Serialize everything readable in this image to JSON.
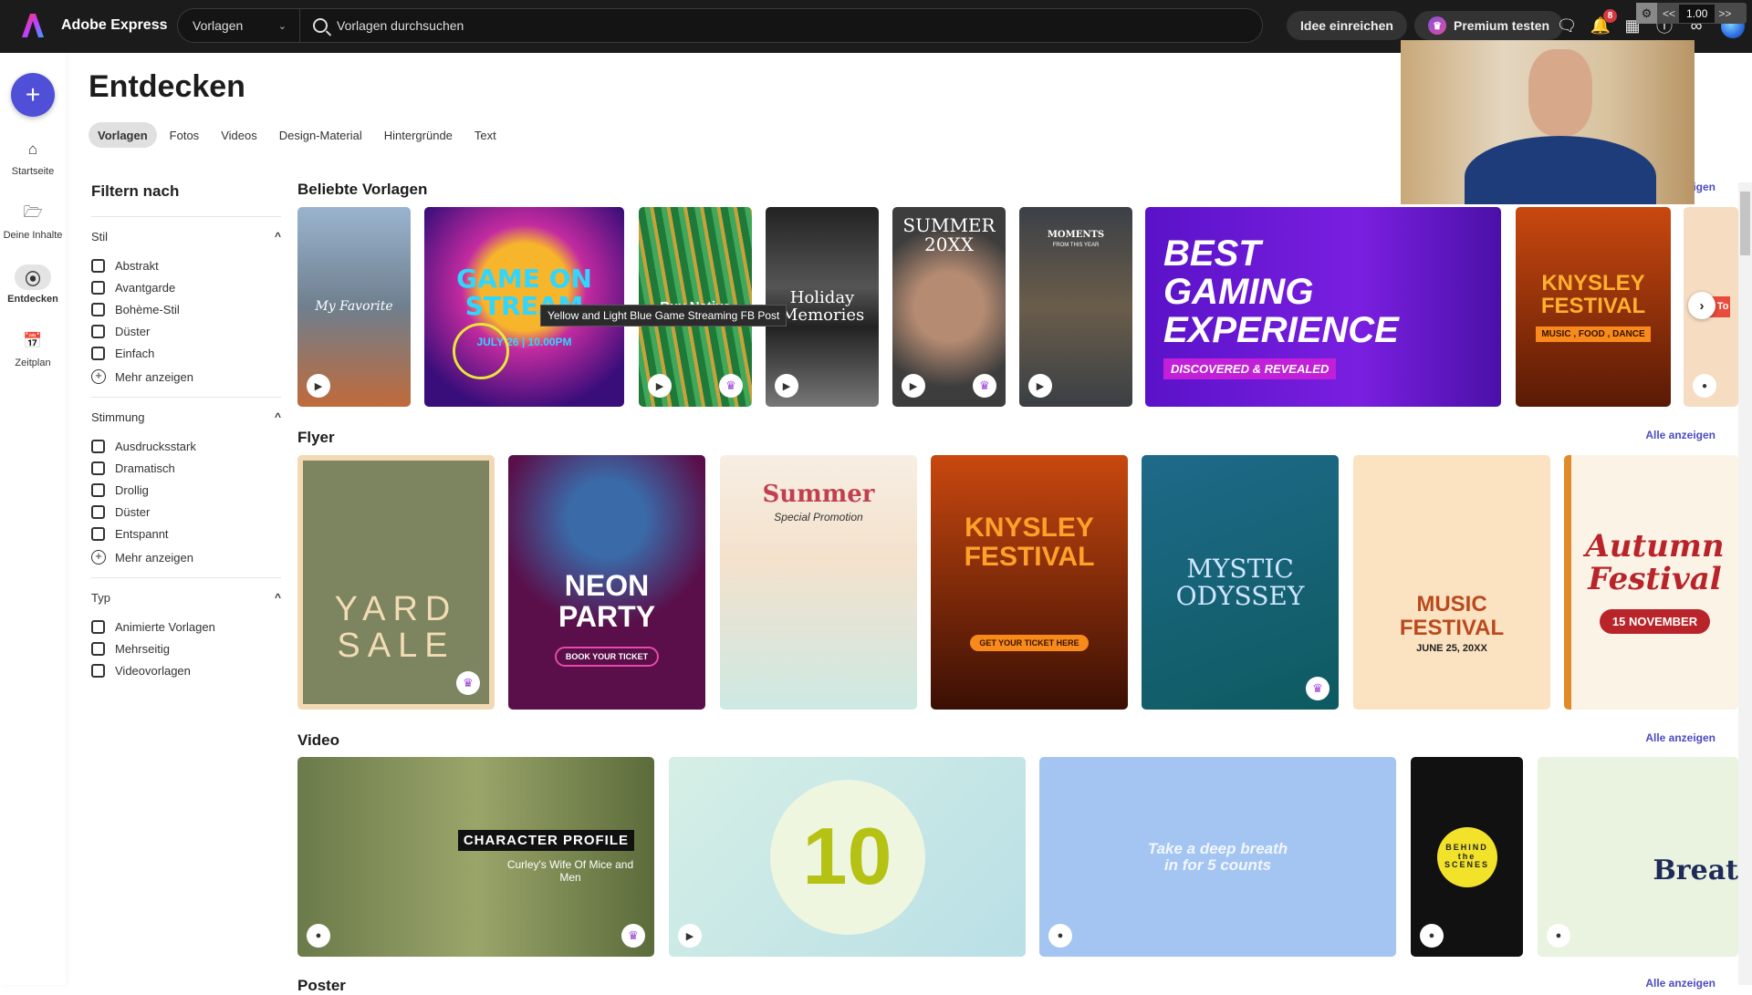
{
  "topbar": {
    "brand": "Adobe Express",
    "scope": "Vorlagen",
    "search_placeholder": "Vorlagen durchsuchen",
    "submit_idea": "Idee einreichen",
    "premium": "Premium testen",
    "notification_count": "8",
    "zoom_overlay": {
      "prev": "<<",
      "value": "1.00",
      "next": ">>"
    }
  },
  "leftnav": {
    "create_label": "+",
    "items": [
      {
        "label": "Startseite",
        "icon": "home-icon"
      },
      {
        "label": "Deine Inhalte",
        "icon": "folder-icon"
      },
      {
        "label": "Entdecken",
        "icon": "compass-icon",
        "active": true
      },
      {
        "label": "Zeitplan",
        "icon": "calendar-icon"
      }
    ]
  },
  "page": {
    "title": "Entdecken",
    "tabs": [
      "Vorlagen",
      "Fotos",
      "Videos",
      "Design-Material",
      "Hintergründe",
      "Text"
    ],
    "active_tab": "Vorlagen"
  },
  "filters": {
    "title": "Filtern nach",
    "more_label": "Mehr anzeigen",
    "sections": [
      {
        "name": "Stil",
        "options": [
          "Abstrakt",
          "Avantgarde",
          "Bohème-Stil",
          "Düster",
          "Einfach"
        ],
        "more": true
      },
      {
        "name": "Stimmung",
        "options": [
          "Ausdrucksstark",
          "Dramatisch",
          "Drollig",
          "Düster",
          "Entspannt"
        ],
        "more": true
      },
      {
        "name": "Typ",
        "options": [
          "Animierte Vorlagen",
          "Mehrseitig",
          "Videovorlagen"
        ],
        "more": false
      }
    ]
  },
  "sections": {
    "popular": {
      "title": "Beliebte Vorlagen",
      "see_all": "Alle anzeigen",
      "tooltip": "Yellow and Light Blue Game Streaming FB Post",
      "cards": [
        {
          "text": "My Favorite",
          "badge_play": true
        },
        {
          "text": "GAME ON STREAM",
          "sub": "JULY 26 | 10.00PM"
        },
        {
          "text": "Buy Native",
          "badge_play": true,
          "premium": true
        },
        {
          "text": "Holiday Memories",
          "badge_play": true
        },
        {
          "text": "SUMMER 20XX",
          "badge_play": true,
          "premium": true
        },
        {
          "text": "MOMENTS",
          "sub": "FROM THIS YEAR",
          "badge_play": true
        },
        {
          "text": "BEST GAMING EXPERIENCE",
          "sub": "DISCOVERED & REVEALED"
        },
        {
          "text": "KNYSLEY FESTIVAL",
          "sub": "MUSIC , FOOD , DANCE"
        },
        {
          "text": "How To"
        }
      ]
    },
    "flyer": {
      "title": "Flyer",
      "see_all": "Alle anzeigen",
      "cards": [
        {
          "text": "YARD SALE",
          "premium": true
        },
        {
          "text": "NEON PARTY",
          "sub": "BOOK YOUR TICKET"
        },
        {
          "text": "Summer",
          "sub": "Special Promotion"
        },
        {
          "text": "KNYSLEY FESTIVAL",
          "sub": "GET YOUR TICKET HERE"
        },
        {
          "text": "MYSTIC ODYSSEY",
          "premium": true
        },
        {
          "text": "MUSIC FESTIVAL",
          "sub": "JUNE 25, 20XX"
        },
        {
          "text": "Autumn Festival",
          "sub": "15 NOVEMBER"
        }
      ]
    },
    "video": {
      "title": "Video",
      "see_all": "Alle anzeigen",
      "cards": [
        {
          "text": "CHARACTER PROFILE",
          "sub": "Curley's Wife Of Mice and Men",
          "premium": true
        },
        {
          "text": "10"
        },
        {
          "text": "Take a deep breath in for 5 counts"
        },
        {
          "text": "BEHIND the SCENES"
        },
        {
          "text": "Breat"
        }
      ]
    },
    "poster": {
      "title": "Poster",
      "see_all": "Alle anzeigen"
    }
  }
}
